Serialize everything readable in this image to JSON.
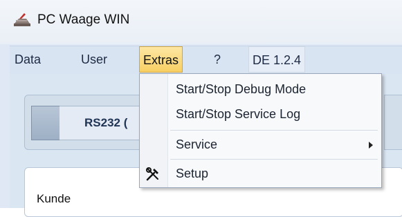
{
  "window": {
    "title": "PC Waage WIN"
  },
  "menubar": {
    "items": [
      {
        "label": "Data"
      },
      {
        "label": "User"
      },
      {
        "label": "Extras"
      },
      {
        "label": "?"
      },
      {
        "label": "DE 1.2.4"
      }
    ]
  },
  "dropdown": {
    "items": [
      {
        "label": "Start/Stop Debug Mode"
      },
      {
        "label": "Start/Stop Service Log"
      },
      {
        "label": "Service"
      },
      {
        "label": "Setup"
      }
    ]
  },
  "connection": {
    "label": "RS232 ("
  },
  "customer": {
    "label": "Kunde"
  },
  "colors": {
    "menu_highlight": "#f8cf63",
    "menubar": "#d9e4f2"
  }
}
